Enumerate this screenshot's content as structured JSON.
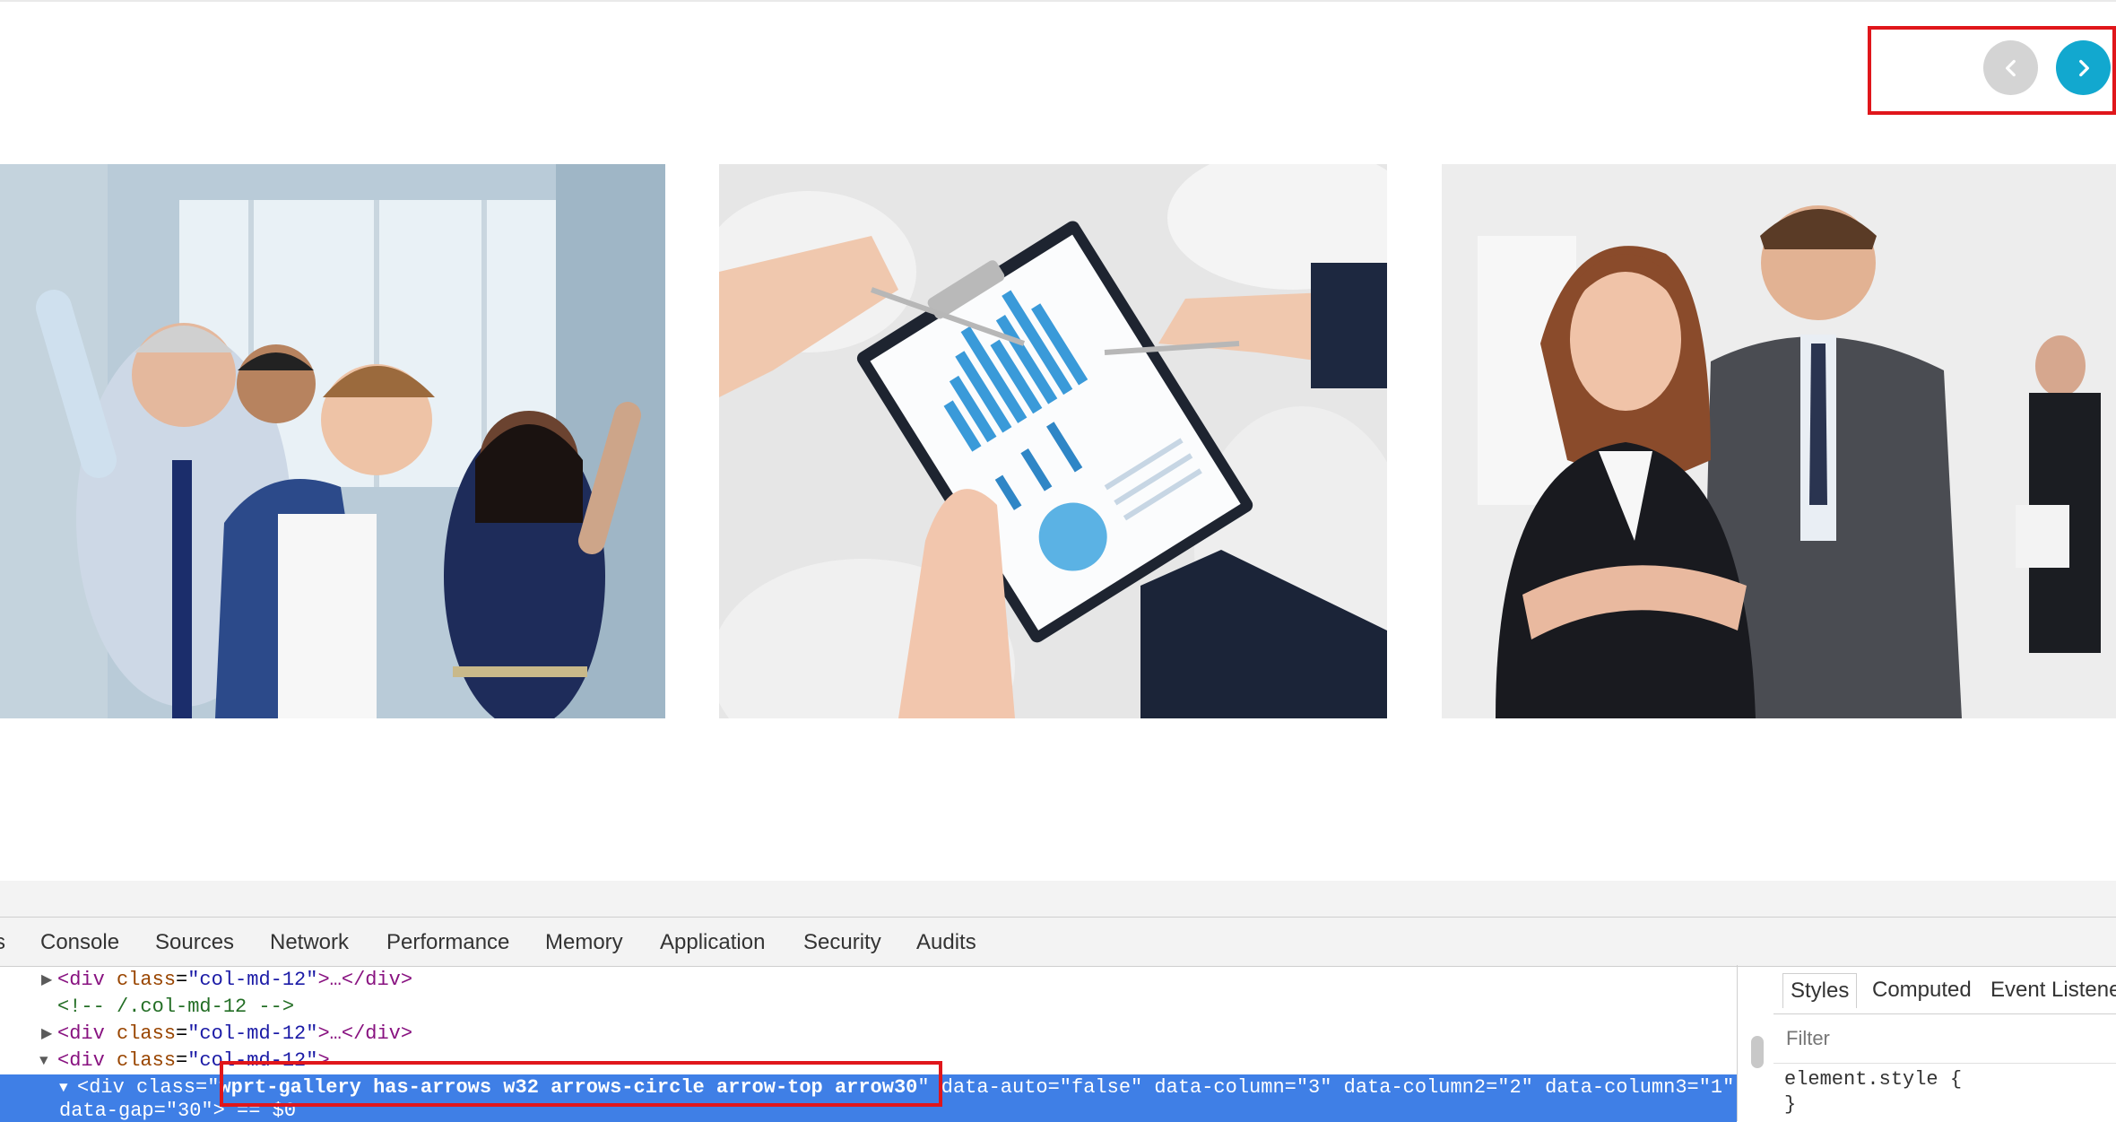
{
  "gallery": {
    "prev_arrow_icon": "chevron-left-icon",
    "next_arrow_icon": "chevron-right-icon",
    "photos": [
      "team-celebrating-photo",
      "clipboard-chart-photo",
      "business-people-photo"
    ]
  },
  "devtools": {
    "tabs": [
      "s",
      "Console",
      "Sources",
      "Network",
      "Performance",
      "Memory",
      "Application",
      "Security",
      "Audits"
    ],
    "lines": {
      "l1_tag_open": "<div ",
      "l1_attr": "class",
      "l1_val": "\"col-md-12\"",
      "l1_rest": ">…</div>",
      "l2_comment": "<!-- /.col-md-12 -->",
      "l3_tag_open": "<div ",
      "l3_attr": "class",
      "l3_val": "\"col-md-12\"",
      "l3_rest": ">…</div>",
      "l4_tag_open": "<div ",
      "l4_attr": "class",
      "l4_val": "\"col-md-12\"",
      "l4_rest": ">",
      "l5_tag_open": "<div ",
      "l5_attr_class": "class",
      "l5_class_value": "wprt-gallery has-arrows w32 arrows-circle arrow-top arrow30",
      "l5_attrs": " data-auto=\"false\" data-column=\"3\" data-column2=\"2\" data-column3=\"1\"",
      "l6_attrs": "data-gap=\"30\"> == $0"
    },
    "styles_tabs": [
      "Styles",
      "Computed",
      "Event Listene"
    ],
    "filter_placeholder": "Filter",
    "element_style": "element.style {",
    "element_style_close": "}"
  },
  "colors": {
    "highlight_red": "#e0161b",
    "arrow_active": "#12a8cf",
    "arrow_inactive": "#d4d4d4",
    "selection_blue": "#3f7fe6"
  }
}
